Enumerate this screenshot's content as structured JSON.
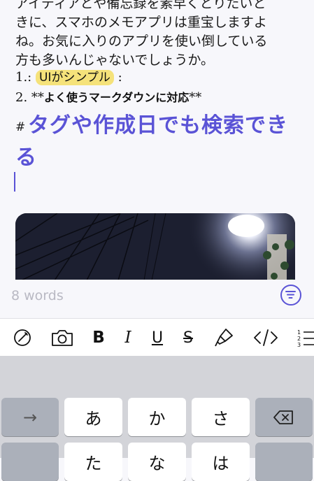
{
  "editor": {
    "paragraph": [
      "アイディアとや備忘録を素早くとりたいと",
      "きに、スマホのメモアプリは重宝しますよ",
      "ね。お気に入りのアプリを使い倒している",
      "方も多いんじゃないでしょうか。"
    ],
    "list1_prefix": "1.:",
    "list1_highlight": "UIがシンプル",
    "list1_suffix": ":",
    "list2_prefix": "2. **",
    "list2_bold": "よく使うマークダウンに対応",
    "list2_suffix": "**",
    "heading_hash": "#",
    "heading_line1": "タグや作成日でも検索でき",
    "heading_line2": "る",
    "accent_color": "#5a53d6",
    "highlight_color": "#f5e27a"
  },
  "status": {
    "word_count": "8 words",
    "filter_icon": "filter-circle-icon"
  },
  "toolbar": {
    "items": [
      {
        "icon": "pen-circle-icon"
      },
      {
        "icon": "camera-icon"
      },
      {
        "label": "B",
        "icon": "bold-icon"
      },
      {
        "label": "I",
        "icon": "italic-icon"
      },
      {
        "label": "U",
        "icon": "underline-icon"
      },
      {
        "label": "S",
        "icon": "strikethrough-icon"
      },
      {
        "icon": "highlighter-icon"
      },
      {
        "label": "</>",
        "icon": "code-icon"
      },
      {
        "icon": "numbered-list-icon"
      }
    ]
  },
  "keyboard": {
    "row1": [
      "→",
      "あ",
      "か",
      "さ",
      "⌫"
    ],
    "row2": [
      "",
      "た",
      "な",
      "は",
      ""
    ]
  }
}
